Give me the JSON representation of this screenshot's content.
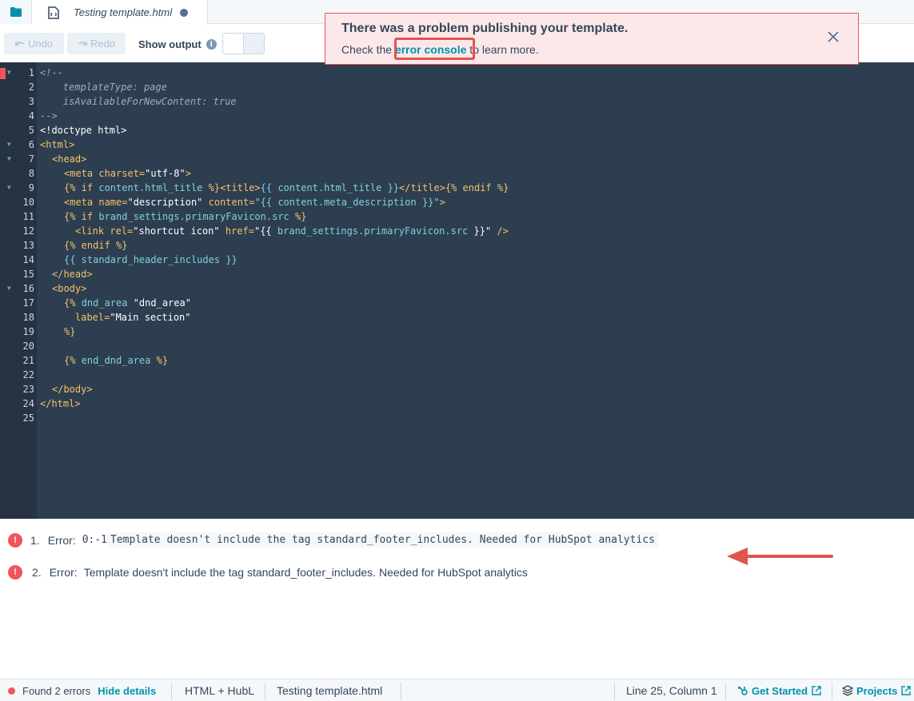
{
  "tab": {
    "title": "Testing template.html"
  },
  "toolbar": {
    "undo_label": "Undo",
    "redo_label": "Redo",
    "show_output_label": "Show output"
  },
  "alert": {
    "title": "There was a problem publishing your template.",
    "body_prefix": "Check the ",
    "link": "error console",
    "body_suffix": " to learn more."
  },
  "editor": {
    "lines": [
      {
        "n": "1"
      },
      {
        "n": "2"
      },
      {
        "n": "3"
      },
      {
        "n": "4"
      },
      {
        "n": "5"
      },
      {
        "n": "6"
      },
      {
        "n": "7"
      },
      {
        "n": "8"
      },
      {
        "n": "9"
      },
      {
        "n": "10"
      },
      {
        "n": "11"
      },
      {
        "n": "12"
      },
      {
        "n": "13"
      },
      {
        "n": "14"
      },
      {
        "n": "15"
      },
      {
        "n": "16"
      },
      {
        "n": "17"
      },
      {
        "n": "18"
      },
      {
        "n": "19"
      },
      {
        "n": "20"
      },
      {
        "n": "21"
      },
      {
        "n": "22"
      },
      {
        "n": "23"
      },
      {
        "n": "24"
      },
      {
        "n": "25"
      }
    ],
    "code": {
      "l1": "<!--",
      "l2": "    templateType: page",
      "l3": "    isAvailableForNewContent: true",
      "l4": "-->",
      "l5": "<!doctype html>",
      "l6": "<html>",
      "l7": "<head>",
      "l8_tag": "<meta",
      "l8_attr": " charset=",
      "l8_str": "\"utf-8\"",
      "l8_end": ">",
      "l9_a": "{% if ",
      "l9_b": "content.html_title",
      "l9_c": " %}<title>",
      "l9_d": "{{ content.html_title }}",
      "l9_e": "</title>{% endif %}",
      "l10_a": "<meta",
      "l10_b": " name=",
      "l10_c": "\"description\"",
      "l10_d": " content=",
      "l10_e": "\"{{ content.meta_description }}\"",
      "l10_f": ">",
      "l11_a": "{% if ",
      "l11_b": "brand_settings.primaryFavicon.src",
      "l11_c": " %}",
      "l12_a": "<link",
      "l12_b": " rel=",
      "l12_c": "\"shortcut icon\"",
      "l12_d": " href=",
      "l12_e": "\"{{ ",
      "l12_f": "brand_settings.primaryFavicon.src",
      "l12_g": " }}\"",
      "l12_h": " />",
      "l13": "{% endif %}",
      "l14": "{{ standard_header_includes }}",
      "l15": "</head>",
      "l16": "<body>",
      "l17_a": "{% ",
      "l17_b": "dnd_area",
      "l17_c": " \"dnd_area\"",
      "l18_a": "label=",
      "l18_b": "\"Main section\"",
      "l19": "%}",
      "l21_a": "{% ",
      "l21_b": "end_dnd_area",
      "l21_c": " %}",
      "l23": "</body>",
      "l24": "</html>"
    }
  },
  "errors": [
    {
      "num": "1.",
      "label": "Error:",
      "code": "0:-1",
      "message": "Template doesn't include the tag standard_footer_includes. Needed for HubSpot analytics"
    },
    {
      "num": "2.",
      "label": "Error:",
      "message": "Template doesn't include the tag standard_footer_includes. Needed for HubSpot analytics"
    }
  ],
  "status": {
    "errors_found": "Found 2 errors",
    "hide_details": "Hide details",
    "language": "HTML + HubL",
    "file": "Testing template.html",
    "cursor": "Line 25, Column 1",
    "get_started": "Get Started",
    "projects": "Projects"
  },
  "colors": {
    "accent": "#0091ae",
    "error": "#f2545b",
    "editor_bg": "#2d3e50"
  },
  "icons": [
    "folder-icon",
    "file-code-icon",
    "undo-icon",
    "redo-icon",
    "info-icon",
    "close-icon",
    "warning-icon",
    "external-link-icon",
    "sprocket-icon",
    "layers-icon"
  ]
}
